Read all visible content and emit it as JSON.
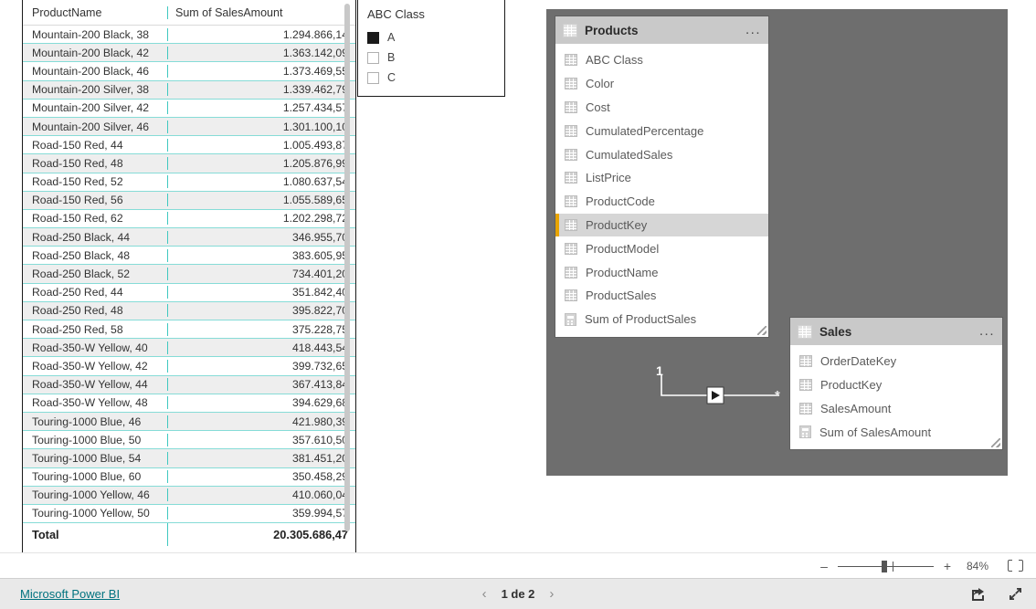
{
  "matrix": {
    "columns": [
      "ProductName",
      "Sum of SalesAmount"
    ],
    "rows": [
      {
        "name": "Mountain-200 Black, 38",
        "value": "1.294.866,14"
      },
      {
        "name": "Mountain-200 Black, 42",
        "value": "1.363.142,09"
      },
      {
        "name": "Mountain-200 Black, 46",
        "value": "1.373.469,55"
      },
      {
        "name": "Mountain-200 Silver, 38",
        "value": "1.339.462,79"
      },
      {
        "name": "Mountain-200 Silver, 42",
        "value": "1.257.434,57"
      },
      {
        "name": "Mountain-200 Silver, 46",
        "value": "1.301.100,10"
      },
      {
        "name": "Road-150 Red, 44",
        "value": "1.005.493,87"
      },
      {
        "name": "Road-150 Red, 48",
        "value": "1.205.876,99"
      },
      {
        "name": "Road-150 Red, 52",
        "value": "1.080.637,54"
      },
      {
        "name": "Road-150 Red, 56",
        "value": "1.055.589,65"
      },
      {
        "name": "Road-150 Red, 62",
        "value": "1.202.298,72"
      },
      {
        "name": "Road-250 Black, 44",
        "value": "346.955,70"
      },
      {
        "name": "Road-250 Black, 48",
        "value": "383.605,95"
      },
      {
        "name": "Road-250 Black, 52",
        "value": "734.401,20"
      },
      {
        "name": "Road-250 Red, 44",
        "value": "351.842,40"
      },
      {
        "name": "Road-250 Red, 48",
        "value": "395.822,70"
      },
      {
        "name": "Road-250 Red, 58",
        "value": "375.228,75"
      },
      {
        "name": "Road-350-W Yellow, 40",
        "value": "418.443,54"
      },
      {
        "name": "Road-350-W Yellow, 42",
        "value": "399.732,65"
      },
      {
        "name": "Road-350-W Yellow, 44",
        "value": "367.413,84"
      },
      {
        "name": "Road-350-W Yellow, 48",
        "value": "394.629,68"
      },
      {
        "name": "Touring-1000 Blue, 46",
        "value": "421.980,39"
      },
      {
        "name": "Touring-1000 Blue, 50",
        "value": "357.610,50"
      },
      {
        "name": "Touring-1000 Blue, 54",
        "value": "381.451,20"
      },
      {
        "name": "Touring-1000 Blue, 60",
        "value": "350.458,29"
      },
      {
        "name": "Touring-1000 Yellow, 46",
        "value": "410.060,04"
      },
      {
        "name": "Touring-1000 Yellow, 50",
        "value": "359.994,57"
      }
    ],
    "total": {
      "label": "Total",
      "value": "20.305.686,47"
    }
  },
  "slicer": {
    "title": "ABC Class",
    "items": [
      {
        "label": "A",
        "checked": true
      },
      {
        "label": "B",
        "checked": false
      },
      {
        "label": "C",
        "checked": false
      }
    ]
  },
  "model": {
    "tables": [
      {
        "name": "Products",
        "menu": "...",
        "fields": [
          {
            "label": "ABC Class",
            "kind": "column",
            "selected": false
          },
          {
            "label": "Color",
            "kind": "column",
            "selected": false
          },
          {
            "label": "Cost",
            "kind": "column",
            "selected": false
          },
          {
            "label": "CumulatedPercentage",
            "kind": "column",
            "selected": false
          },
          {
            "label": "CumulatedSales",
            "kind": "column",
            "selected": false
          },
          {
            "label": "ListPrice",
            "kind": "column",
            "selected": false
          },
          {
            "label": "ProductCode",
            "kind": "column",
            "selected": false
          },
          {
            "label": "ProductKey",
            "kind": "column",
            "selected": true
          },
          {
            "label": "ProductModel",
            "kind": "column",
            "selected": false
          },
          {
            "label": "ProductName",
            "kind": "column",
            "selected": false
          },
          {
            "label": "ProductSales",
            "kind": "column",
            "selected": false
          },
          {
            "label": "Sum of ProductSales",
            "kind": "measure",
            "selected": false
          }
        ]
      },
      {
        "name": "Sales",
        "menu": "...",
        "fields": [
          {
            "label": "OrderDateKey",
            "kind": "column",
            "selected": false
          },
          {
            "label": "ProductKey",
            "kind": "column",
            "selected": false
          },
          {
            "label": "SalesAmount",
            "kind": "column",
            "selected": false
          },
          {
            "label": "Sum of SalesAmount",
            "kind": "measure",
            "selected": false
          }
        ]
      }
    ],
    "relationship": {
      "from_cardinality": "1",
      "to_cardinality": "*",
      "canvas_color": "#6e6e6e"
    }
  },
  "status": {
    "zoom_minus": "–",
    "zoom_plus": "+",
    "zoom_percent": "84%",
    "fit_icon": "fit-to-page-icon"
  },
  "footer": {
    "brand_link": "Microsoft Power BI",
    "prev_icon": "chevron-left-icon",
    "page_indicator": "1 de 2",
    "next_icon": "chevron-right-icon",
    "share_icon": "share-icon",
    "fullscreen_icon": "fullscreen-icon"
  },
  "colors": {
    "accent_teal": "#00727f",
    "row_border": "#86dcd7",
    "selection_bar": "#e8a400",
    "canvas": "#6e6e6e"
  }
}
